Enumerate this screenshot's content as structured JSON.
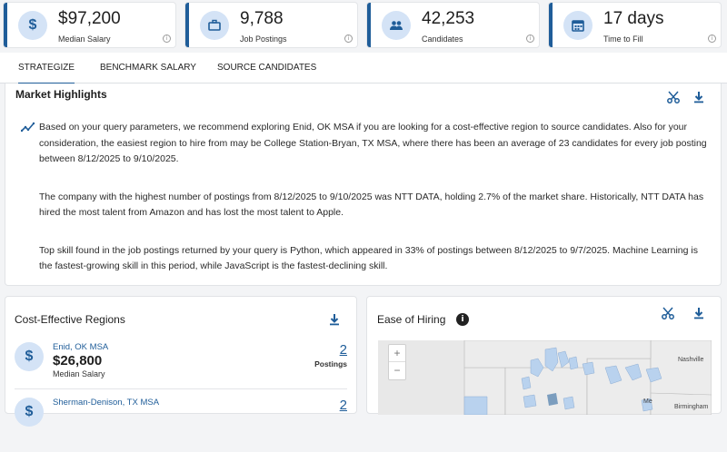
{
  "kpis": [
    {
      "icon": "dollar-icon",
      "glyph": "$",
      "value": "$97,200",
      "label": "Median Salary"
    },
    {
      "icon": "briefcase-icon",
      "glyph": "",
      "value": "9,788",
      "label": "Job Postings"
    },
    {
      "icon": "people-icon",
      "glyph": "",
      "value": "42,253",
      "label": "Candidates"
    },
    {
      "icon": "calendar-icon",
      "glyph": "",
      "value": "17 days",
      "label": "Time to Fill"
    }
  ],
  "tabs": [
    {
      "label": "STRATEGIZE",
      "active": true
    },
    {
      "label": "BENCHMARK SALARY",
      "active": false
    },
    {
      "label": "SOURCE CANDIDATES",
      "active": false
    }
  ],
  "market_highlights": {
    "title": "Market Highlights",
    "paragraphs": [
      "Based on your query parameters, we recommend exploring Enid, OK MSA if you are looking for a cost-effective region to source candidates. Also for your consideration, the easiest region to hire from may be College Station-Bryan, TX MSA, where there has been an average of 23 candidates for every job posting between 8/12/2025 to 9/10/2025.",
      "The company with the highest number of postings from 8/12/2025 to 9/10/2025 was NTT DATA, holding 2.7% of the market share. Historically, NTT DATA has hired the most talent from Amazon and has lost the most talent to Apple.",
      "Top skill found in the job postings returned by your query is Python, which appeared in 33% of postings between 8/12/2025 to 9/7/2025. Machine Learning is the fastest-growing skill in this period, while JavaScript is the fastest-declining skill."
    ]
  },
  "cost_effective": {
    "title": "Cost-Effective Regions",
    "regions": [
      {
        "name": "Enid, OK MSA",
        "salary": "$26,800",
        "salary_label": "Median Salary",
        "count": "2",
        "count_label": "Postings"
      },
      {
        "name": "Sherman-Denison, TX MSA",
        "salary": "",
        "salary_label": "",
        "count": "2",
        "count_label": ""
      }
    ]
  },
  "ease_of_hiring": {
    "title": "Ease of Hiring",
    "info": "i",
    "zoom_in": "+",
    "zoom_out": "−",
    "map_labels": {
      "nashville": "Nashville",
      "birmingham": "Birmingham",
      "me": "Me"
    }
  },
  "colors": {
    "accent": "#1f5d99",
    "icon_bg": "#d4e3f6",
    "map_fill": "#b9d2ee"
  }
}
